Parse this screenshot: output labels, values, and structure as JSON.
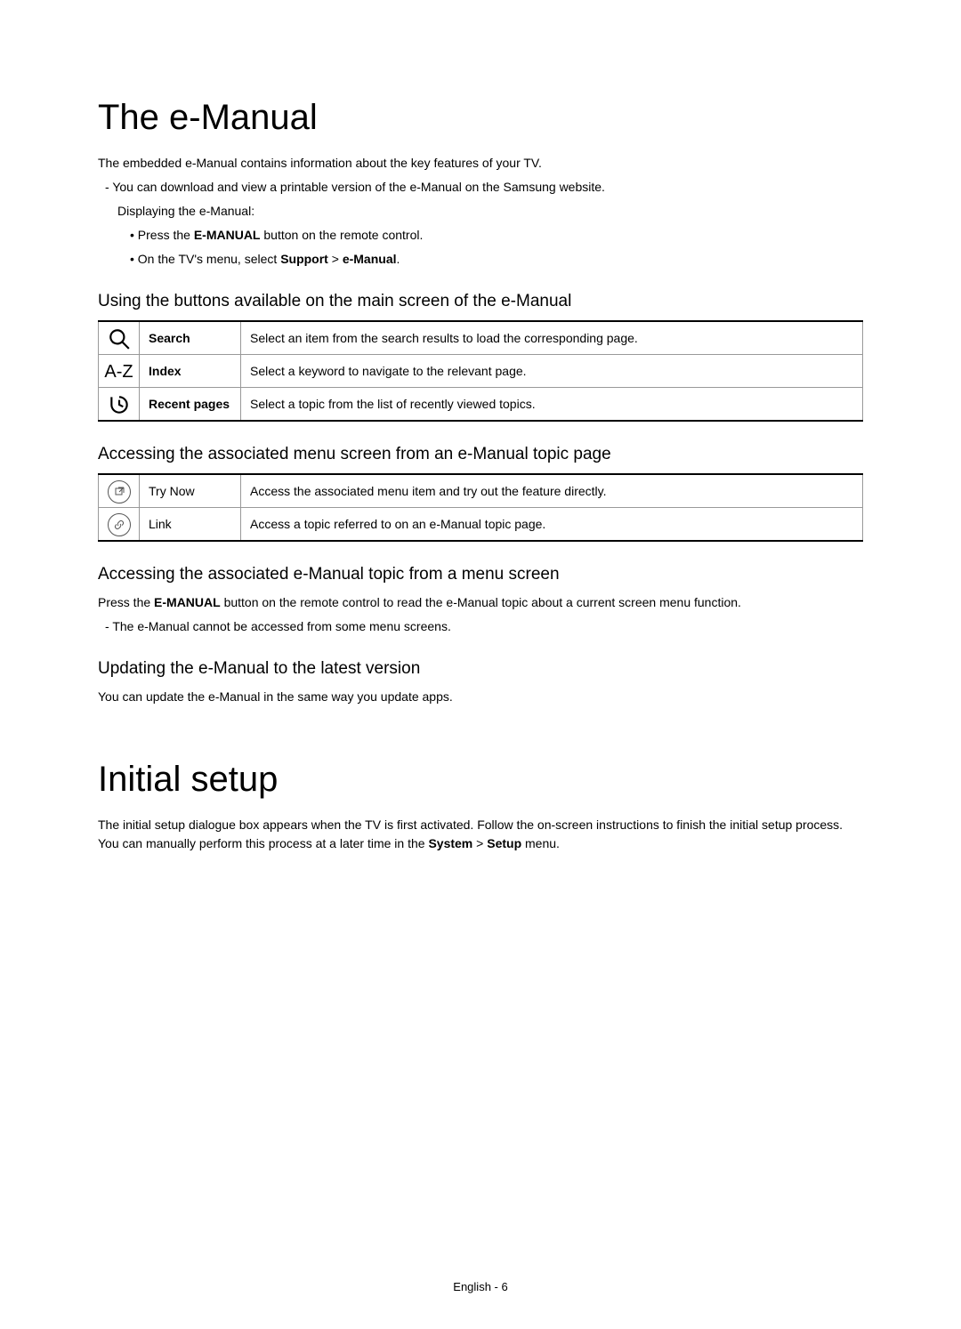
{
  "section1": {
    "title": "The e-Manual",
    "intro": "The embedded e-Manual contains information about the key features of your TV.",
    "bullets": {
      "download": "You can download and view a printable version of the e-Manual on the Samsung website.",
      "displaying": "Displaying the e-Manual:",
      "press_pre": "Press the ",
      "press_bold": "E-MANUAL",
      "press_post": " button on the remote control.",
      "menu_pre": "On the TV's menu, select ",
      "menu_b1": "Support",
      "menu_sep": " > ",
      "menu_b2": "e-Manual",
      "menu_post": "."
    },
    "sub1": {
      "heading": "Using the buttons available on the main screen of the e-Manual",
      "rows": [
        {
          "label": "Search",
          "desc": "Select an item from the search results to load the corresponding page."
        },
        {
          "label": "Index",
          "desc": "Select a keyword to navigate to the relevant page."
        },
        {
          "label": "Recent pages",
          "desc": "Select a topic from the list of recently viewed topics."
        }
      ],
      "index_icon_text": "A-Z"
    },
    "sub2": {
      "heading": "Accessing the associated menu screen from an e-Manual topic page",
      "rows": [
        {
          "label": "Try Now",
          "desc": "Access the associated menu item and try out the feature directly."
        },
        {
          "label": "Link",
          "desc": "Access a topic referred to on an e-Manual topic page."
        }
      ]
    },
    "sub3": {
      "heading": "Accessing the associated e-Manual topic from a menu screen",
      "line_pre": "Press the ",
      "line_bold": "E-MANUAL",
      "line_post": " button on the remote control to read the e-Manual topic about a current screen menu function.",
      "note": "The e-Manual cannot be accessed from some menu screens."
    },
    "sub4": {
      "heading": "Updating the e-Manual to the latest version",
      "line": "You can update the e-Manual in the same way you update apps."
    }
  },
  "section2": {
    "title": "Initial setup",
    "para_pre": "The initial setup dialogue box appears when the TV is first activated. Follow the on-screen instructions to finish the initial setup process. You can manually perform this process at a later time in the ",
    "b1": "System",
    "sep": " > ",
    "b2": "Setup",
    "para_post": " menu."
  },
  "footer": "English - 6"
}
